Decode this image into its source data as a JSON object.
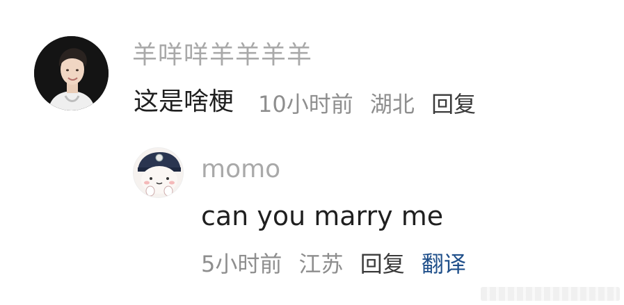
{
  "comment": {
    "username": "羊咩咩羊羊羊羊",
    "text": "这是啥梗",
    "time": "10小时前",
    "location": "湖北",
    "reply_label": "回复"
  },
  "reply": {
    "username": "momo",
    "text": "can you marry me",
    "time": "5小时前",
    "location": "江苏",
    "reply_label": "回复",
    "translate_label": "翻译"
  },
  "colors": {
    "username": "#a9a9a9",
    "body_text": "#1f1f1f",
    "meta_text": "#8e8e8e",
    "translate_link": "#1f4f8a"
  }
}
